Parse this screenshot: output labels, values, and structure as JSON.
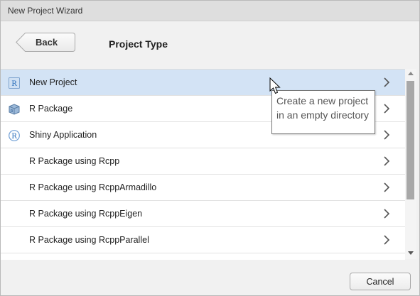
{
  "window": {
    "title": "New Project Wizard"
  },
  "header": {
    "back_label": "Back",
    "title": "Project Type"
  },
  "projects": [
    {
      "label": "New Project",
      "icon": "r-project-icon",
      "selected": true
    },
    {
      "label": "R Package",
      "icon": "r-package-icon",
      "selected": false
    },
    {
      "label": "Shiny Application",
      "icon": "shiny-icon",
      "selected": false
    },
    {
      "label": "R Package using Rcpp",
      "icon": "",
      "selected": false
    },
    {
      "label": "R Package using RcppArmadillo",
      "icon": "",
      "selected": false
    },
    {
      "label": "R Package using RcppEigen",
      "icon": "",
      "selected": false
    },
    {
      "label": "R Package using RcppParallel",
      "icon": "",
      "selected": false
    }
  ],
  "tooltip": {
    "text": "Create a new project in an empty directory"
  },
  "footer": {
    "cancel_label": "Cancel"
  },
  "colors": {
    "selected_row": "#d3e3f5",
    "r_blue": "#2a6ebb"
  }
}
